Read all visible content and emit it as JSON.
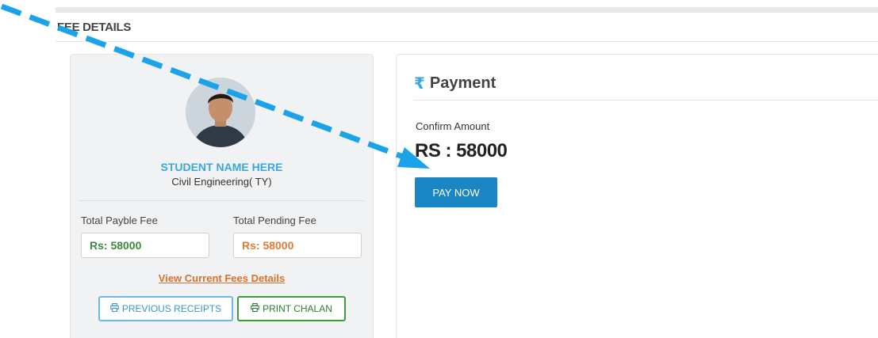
{
  "section": {
    "title": "FEE DETAILS"
  },
  "student": {
    "name": "STUDENT NAME HERE",
    "department": "Civil Engineering( TY)",
    "total_payable_label": "Total Payble Fee",
    "total_payable_value": "Rs: 58000",
    "total_pending_label": "Total Pending Fee",
    "total_pending_value": "Rs: 58000",
    "view_fees_link": "View Current Fees Details",
    "previous_receipts_label": "PREVIOUS RECEIPTS",
    "print_chalan_label": "PRINT CHALAN"
  },
  "payment": {
    "header": "Payment",
    "confirm_label": "Confirm Amount",
    "amount": "RS : 58000",
    "pay_button": "PAY NOW"
  },
  "icons": {
    "rupee": "rupee-icon",
    "printer": "printer-icon",
    "avatar": "avatar"
  },
  "colors": {
    "accent_blue": "#3aa7e0",
    "pay_button": "#1a86c4",
    "payable_green": "#3c8a3c",
    "pending_orange": "#e07a3a",
    "link_orange": "#d9712e",
    "annotation_arrow": "#1aa3e8"
  }
}
